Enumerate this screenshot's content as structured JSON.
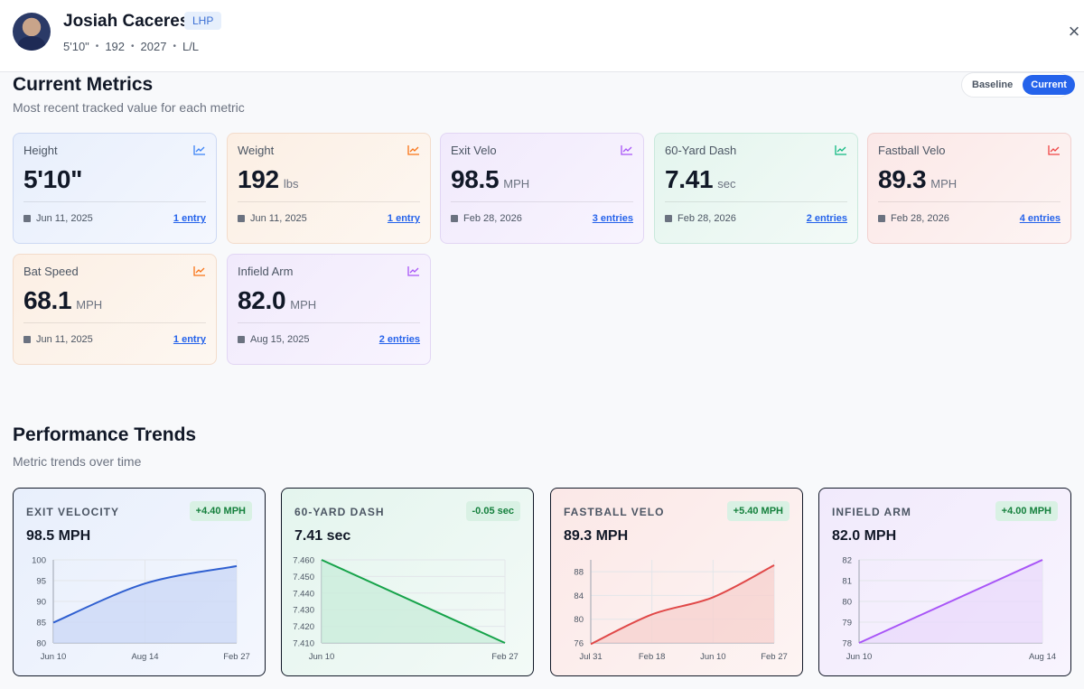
{
  "player": {
    "name": "Josiah Caceres",
    "position": "LHP",
    "meta": [
      "5'10\"",
      "192",
      "2027",
      "L/L"
    ]
  },
  "close_label": "×",
  "current_metrics": {
    "title": "Current Metrics",
    "subtitle": "Most recent tracked value for each metric",
    "toggle": {
      "baseline": "Baseline",
      "current": "Current",
      "active": "current"
    },
    "cards": [
      {
        "label": "Height",
        "value": "5'10\"",
        "unit": "",
        "date": "Jun 11, 2025",
        "entries": "1 entry",
        "color": "#3b82f6"
      },
      {
        "label": "Weight",
        "value": "192",
        "unit": "lbs",
        "date": "Jun 11, 2025",
        "entries": "1 entry",
        "color": "#f97316"
      },
      {
        "label": "Exit Velo",
        "value": "98.5",
        "unit": "MPH",
        "date": "Feb 28, 2026",
        "entries": "3 entries",
        "color": "#a855f7"
      },
      {
        "label": "60-Yard Dash",
        "value": "7.41",
        "unit": "sec",
        "date": "Feb 28, 2026",
        "entries": "2 entries",
        "color": "#10b981"
      },
      {
        "label": "Fastball Velo",
        "value": "89.3",
        "unit": "MPH",
        "date": "Feb 28, 2026",
        "entries": "4 entries",
        "color": "#ef4444"
      },
      {
        "label": "Bat Speed",
        "value": "68.1",
        "unit": "MPH",
        "date": "Jun 11, 2025",
        "entries": "1 entry",
        "color": "#f97316"
      },
      {
        "label": "Infield Arm",
        "value": "82.0",
        "unit": "MPH",
        "date": "Aug 15, 2025",
        "entries": "2 entries",
        "color": "#a855f7"
      }
    ]
  },
  "performance_trends": {
    "title": "Performance Trends",
    "subtitle": "Metric trends over time"
  },
  "chart_data": [
    {
      "type": "area",
      "title": "EXIT VELOCITY",
      "value": "98.5 MPH",
      "delta": "+4.40 MPH",
      "color": "#2f5fd0",
      "fill": "#c9d7f5",
      "x": [
        "Jun 10",
        "Aug 14",
        "Feb 27"
      ],
      "y": [
        84.9,
        94.3,
        98.5
      ],
      "curve": "smooth",
      "ylim": [
        80,
        100
      ],
      "yticks": [
        80,
        85,
        90,
        95,
        100
      ],
      "ytick_labels": [
        "80",
        "85",
        "90",
        "95",
        "100"
      ],
      "xtick_labels": [
        "Jun 10",
        "Aug 14",
        "Feb 27"
      ],
      "grid": true
    },
    {
      "type": "area",
      "title": "60-YARD DASH",
      "value": "7.41 sec",
      "delta": "-0.05 sec",
      "color": "#16a34a",
      "fill": "#c8ecd9",
      "x": [
        "Jun 10",
        "Feb 27"
      ],
      "y": [
        7.46,
        7.41
      ],
      "curve": "linear",
      "ylim": [
        7.41,
        7.46
      ],
      "yticks": [
        7.41,
        7.42,
        7.43,
        7.44,
        7.45,
        7.46
      ],
      "ytick_labels": [
        "7.410",
        "7.420",
        "7.430",
        "7.440",
        "7.450",
        "7.460"
      ],
      "xtick_labels": [
        "Jun 10",
        "Feb 27"
      ],
      "grid": true
    },
    {
      "type": "area",
      "title": "FASTBALL VELO",
      "value": "89.3 MPH",
      "delta": "+5.40 MPH",
      "color": "#e04848",
      "fill": "#f7d0ce",
      "x": [
        "Jul 31",
        "Feb 18",
        "Jun 10",
        "Feb 27"
      ],
      "y": [
        75.8,
        80.8,
        83.7,
        89.1
      ],
      "curve": "smooth",
      "ylim": [
        76,
        90
      ],
      "yticks": [
        76,
        80,
        84,
        88
      ],
      "ytick_labels": [
        "76",
        "80",
        "84",
        "88"
      ],
      "xtick_labels": [
        "Jul 31",
        "Feb 18",
        "Jun 10",
        "Feb 27"
      ],
      "grid": true
    },
    {
      "type": "area",
      "title": "INFIELD ARM",
      "value": "82.0 MPH",
      "delta": "+4.00 MPH",
      "color": "#a855f7",
      "fill": "#e9dafb",
      "x": [
        "Jun 10",
        "Aug 14"
      ],
      "y": [
        78,
        82
      ],
      "curve": "linear",
      "ylim": [
        78,
        82
      ],
      "yticks": [
        78,
        79,
        80,
        81,
        82
      ],
      "ytick_labels": [
        "78",
        "79",
        "80",
        "81",
        "82"
      ],
      "xtick_labels": [
        "Jun 10",
        "Aug 14"
      ],
      "grid": true
    }
  ]
}
